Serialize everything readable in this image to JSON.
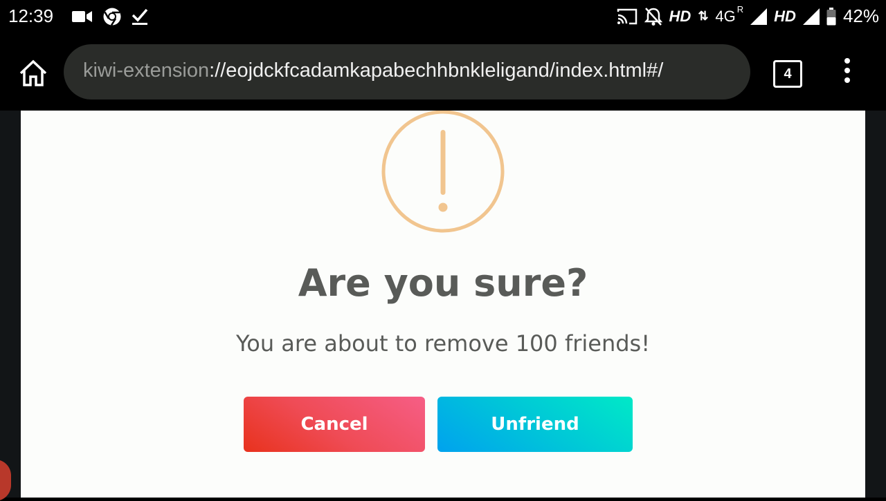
{
  "status_bar": {
    "time": "12:39",
    "network_1": "HD",
    "network_type": "4G",
    "roaming": "R",
    "network_2": "HD",
    "battery": "42%"
  },
  "browser": {
    "url_scheme": "kiwi-extension",
    "url_rest": "://eojdckfcadamkapabechhbnkleligand/index.html#/",
    "tab_count": "4"
  },
  "dialog": {
    "title": "Are you sure?",
    "message": "You are about to remove 100 friends!",
    "cancel_label": "Cancel",
    "confirm_label": "Unfriend"
  },
  "colors": {
    "warning_icon": "#f1c58f",
    "cancel_start": "#e8321d",
    "cancel_end": "#f65e86",
    "confirm_start": "#00a2ee",
    "confirm_end": "#00e9c7",
    "text": "#595b58"
  },
  "icons": {
    "status": [
      "video-camera-icon",
      "chrome-icon",
      "download-done-icon",
      "cast-icon",
      "notifications-off-icon",
      "signal-icon",
      "battery-icon"
    ],
    "toolbar": [
      "home-icon",
      "tabs-icon",
      "more-vert-icon"
    ],
    "dialog": "warning-icon"
  }
}
